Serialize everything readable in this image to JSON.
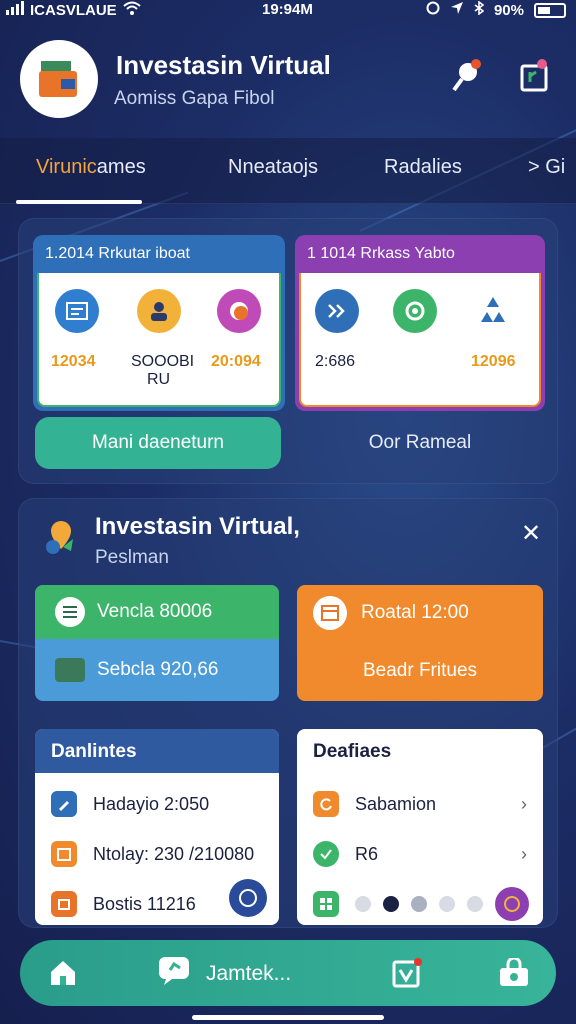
{
  "status_bar": {
    "carrier": "ICASVLAUE",
    "time": "19:94M",
    "battery": "90%"
  },
  "header": {
    "title": "Investasin Virtual",
    "subtitle": "Aomiss Gapa Fibol"
  },
  "tabs": [
    {
      "label_highlight": "Virunic",
      "label_rest": "ames"
    },
    {
      "label": "Nneataojs"
    },
    {
      "label": "Radalies"
    },
    {
      "label": "> Gi"
    }
  ],
  "top_panel": {
    "card_left": {
      "title": "1.2014 Rrkutar iboat",
      "values": [
        "12034",
        "SOOOBI",
        "RU",
        "20:094"
      ]
    },
    "card_right": {
      "title": "1 1014 Rrkass Yabto",
      "values": [
        "2:686",
        "12096"
      ]
    },
    "button_primary": "Mani daeneturn",
    "button_secondary": "Oor Rameal"
  },
  "second_panel": {
    "title": "Investasin Virtual,",
    "subtitle": "Peslman",
    "tile_green": "Vencla 80006",
    "tile_blue": "Sebcla 920,66",
    "tile_orange_top": "Roatal 12:00",
    "tile_orange_bottom": "Beadr Fritues",
    "list_left": {
      "title": "Danlintes",
      "items": [
        "Hadayio 2:050",
        "Ntolay: 230 /210080",
        "Bostis 11216"
      ]
    },
    "list_right": {
      "title": "Deafiaes",
      "items": [
        "Sabamion",
        "R6"
      ]
    }
  },
  "bottom_nav": {
    "center_label": "Jamtek..."
  },
  "colors": {
    "accent_teal": "#34b394",
    "accent_orange": "#f08a2c",
    "accent_blue": "#2f6fb8",
    "accent_purple": "#8c3fb0",
    "accent_green": "#3cb56a"
  },
  "icons": [
    "signal-icon",
    "wifi-icon",
    "location-icon",
    "bluetooth-icon",
    "battery-icon",
    "search-icon",
    "plant-icon",
    "home-icon",
    "chat-icon",
    "calendar-icon",
    "bag-icon"
  ]
}
